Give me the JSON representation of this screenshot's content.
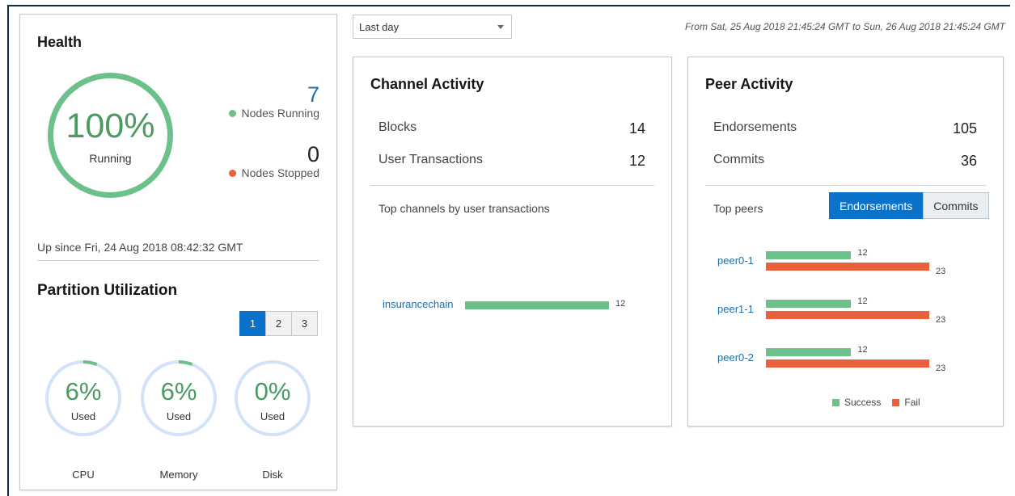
{
  "health": {
    "title": "Health",
    "running_pct": "100%",
    "running_label": "Running",
    "nodes_running": "7",
    "nodes_running_label": "Nodes Running",
    "nodes_stopped": "0",
    "nodes_stopped_label": "Nodes Stopped",
    "up_since": "Up since Fri, 24 Aug 2018 08:42:32 GMT",
    "running_color": "#6cc08a",
    "stopped_color": "#e8603c"
  },
  "partition": {
    "title": "Partition Utilization",
    "pages": [
      "1",
      "2",
      "3"
    ],
    "active_page": "1",
    "gauges": [
      {
        "pct": "6%",
        "used": "Used",
        "name": "CPU",
        "fraction": 0.06
      },
      {
        "pct": "6%",
        "used": "Used",
        "name": "Memory",
        "fraction": 0.06
      },
      {
        "pct": "0%",
        "used": "Used",
        "name": "Disk",
        "fraction": 0.0
      }
    ]
  },
  "range": {
    "selected": "Last day",
    "text": "From Sat, 25 Aug 2018 21:45:24 GMT to Sun, 26 Aug 2018 21:45:24 GMT"
  },
  "channel": {
    "title": "Channel Activity",
    "blocks_label": "Blocks",
    "blocks": "14",
    "tx_label": "User Transactions",
    "tx": "12",
    "top_label": "Top channels by user transactions"
  },
  "peer": {
    "title": "Peer Activity",
    "endorsements_label": "Endorsements",
    "endorsements": "105",
    "commits_label": "Commits",
    "commits": "36",
    "top_label": "Top peers",
    "toggle": [
      "Endorsements",
      "Commits"
    ],
    "legend_success": "Success",
    "legend_fail": "Fail"
  },
  "chart_data": [
    {
      "type": "bar",
      "categories": [
        "insurancechain"
      ],
      "series": [
        {
          "values": [
            12
          ]
        }
      ],
      "colors": [
        "#6cc08a"
      ]
    },
    {
      "type": "bar",
      "categories": [
        "peer0-1",
        "peer1-1",
        "peer0-2"
      ],
      "series": [
        {
          "name": "Success",
          "values": [
            12,
            12,
            12
          ]
        },
        {
          "name": "Fail",
          "values": [
            23,
            23,
            23
          ]
        }
      ],
      "colors": [
        "#6cc08a",
        "#e8603c"
      ]
    }
  ]
}
